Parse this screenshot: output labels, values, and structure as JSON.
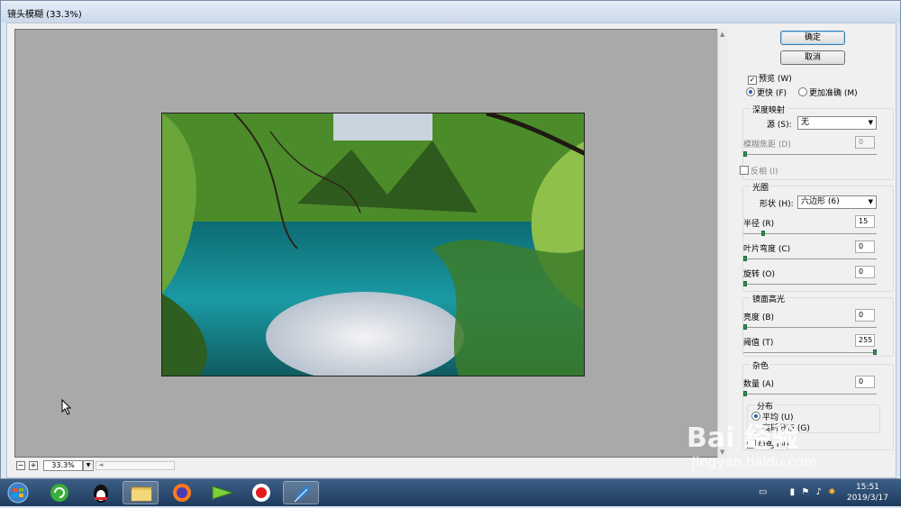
{
  "window": {
    "title": "镜头模糊 (33.3%)"
  },
  "zoom": {
    "value": "33.3%",
    "minus": "−",
    "plus": "+"
  },
  "buttons": {
    "ok": "确定",
    "cancel": "取消"
  },
  "preview": {
    "checkbox": "预览 (W)",
    "checked": true,
    "faster": "更快 (F)",
    "accurate": "更加准确 (M)"
  },
  "depth_map": {
    "legend": "深度映射",
    "source_label": "源 (S):",
    "source_value": "无",
    "blur_focal_label": "模糊焦距 (D)",
    "blur_focal_value": "0",
    "invert_label": "反相 (I)"
  },
  "iris": {
    "legend": "光圈",
    "shape_label": "形状 (H):",
    "shape_value": "六边形 (6)",
    "radius_label": "半径 (R)",
    "radius_value": "15",
    "blade_label": "叶片弯度 (C)",
    "blade_value": "0",
    "rotation_label": "旋转 (O)",
    "rotation_value": "0"
  },
  "specular": {
    "legend": "镜面高光",
    "brightness_label": "亮度 (B)",
    "brightness_value": "0",
    "threshold_label": "阈值 (T)",
    "threshold_value": "255"
  },
  "noise": {
    "legend": "杂色",
    "amount_label": "数量 (A)",
    "amount_value": "0",
    "distribution_legend": "分布",
    "uniform": "平均 (U)",
    "gaussian": "高斯分布 (G)",
    "mono": "单色 (N)"
  },
  "watermark": {
    "brand": "Bai 经验",
    "url": "jingyan.baidu.com"
  },
  "clock": {
    "time": "15:51",
    "date": "2019/3/17"
  },
  "colors": {
    "accent": "#3c7fb1",
    "slider_thumb": "#2f8e52",
    "canvas_bg": "#a9a9a9",
    "taskbar": "#2a4a70"
  },
  "taskbar_icons": [
    "windows-start-icon",
    "green-refresh-icon",
    "qq-penguin-icon",
    "file-explorer-icon",
    "firefox-icon",
    "media-player-icon",
    "screen-recorder-icon",
    "feather-app-icon"
  ]
}
